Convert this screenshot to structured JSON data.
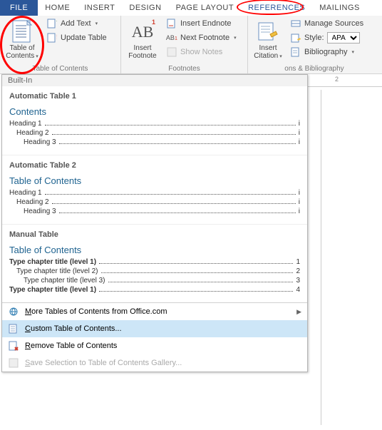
{
  "tabs": {
    "file": "FILE",
    "home": "HOME",
    "insert": "INSERT",
    "design": "DESIGN",
    "pagelayout": "PAGE LAYOUT",
    "references": "REFERENCES",
    "mailings": "MAILINGS"
  },
  "ribbon": {
    "toc": {
      "label1": "Table of",
      "label2": "Contents"
    },
    "addtext": "Add Text",
    "updatetable": "Update Table",
    "group_toc": "Table of Contents",
    "insertfoot": {
      "label1": "Insert",
      "label2": "Footnote"
    },
    "endnote": "Insert Endnote",
    "nextfoot": "Next Footnote",
    "shownotes": "Show Notes",
    "group_footnotes": "Footnotes",
    "insertcite": {
      "label1": "Insert",
      "label2": "Citation"
    },
    "manage": "Manage Sources",
    "style_label": "Style:",
    "style_value": "APA",
    "biblio": "Bibliography",
    "group_cite": "ons & Bibliography"
  },
  "ruler": {
    "n2": "2"
  },
  "dropdown": {
    "section_builtin": "Built-In",
    "auto1": {
      "title": "Automatic Table 1",
      "ptitle": "Contents",
      "h1": "Heading 1",
      "h2": "Heading 2",
      "h3": "Heading 3",
      "p": "i"
    },
    "auto2": {
      "title": "Automatic Table 2",
      "ptitle": "Table of Contents",
      "h1": "Heading 1",
      "h2": "Heading 2",
      "h3": "Heading 3",
      "p": "i"
    },
    "manual": {
      "title": "Manual Table",
      "ptitle": "Table of Contents",
      "r1": "Type chapter title (level 1)",
      "p1": "1",
      "r2": "Type chapter title (level 2)",
      "p2": "2",
      "r3": "Type chapter title (level 3)",
      "p3": "3",
      "r4": "Type chapter title (level 1)",
      "p4": "4"
    },
    "more": "More Tables of Contents from Office.com",
    "custom": "Custom Table of Contents...",
    "remove": "Remove Table of Contents",
    "save": "Save Selection to Table of Contents Gallery..."
  }
}
